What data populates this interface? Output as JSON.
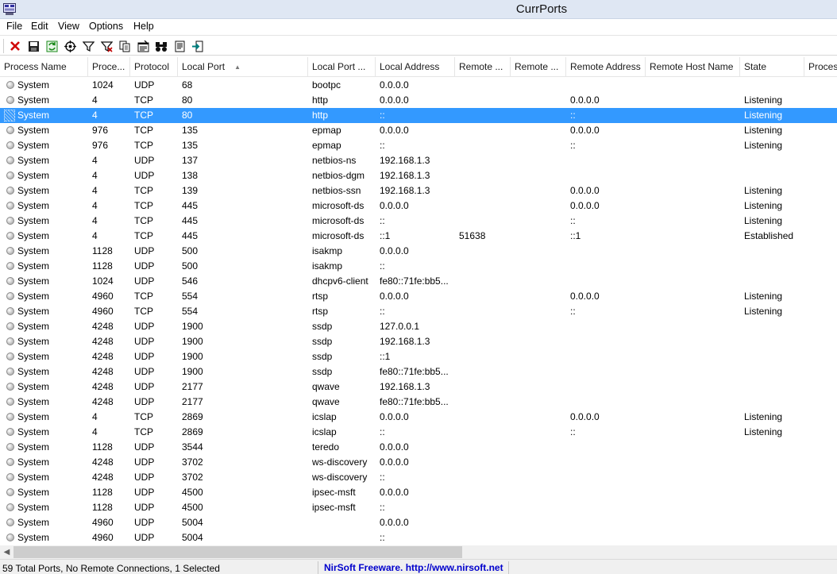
{
  "window": {
    "title": "CurrPorts"
  },
  "menu": [
    "File",
    "Edit",
    "View",
    "Options",
    "Help"
  ],
  "toolbar": {
    "buttons": [
      {
        "name": "close-connections-icon",
        "color": "#d00000"
      },
      {
        "name": "save-icon",
        "color": "#1a1a1a"
      },
      {
        "name": "refresh-icon",
        "color": "#1a8a1a"
      },
      {
        "name": "crosshair-icon",
        "color": "#1a1a1a"
      },
      {
        "name": "filter-icon",
        "color": "#1a1a1a"
      },
      {
        "name": "filter-red-icon",
        "color": "#c00000"
      },
      {
        "name": "copy-icon",
        "color": "#1a1a1a"
      },
      {
        "name": "properties-icon",
        "color": "#1a1a1a"
      },
      {
        "name": "find-binoculars-icon",
        "color": "#1a1a1a"
      },
      {
        "name": "html-report-icon",
        "color": "#1a1a1a"
      },
      {
        "name": "exit-icon",
        "color": "#008080"
      }
    ]
  },
  "columns": [
    "Process Name",
    "Proce...",
    "Protocol",
    "Local Port",
    "Local Port ...",
    "Local Address",
    "Remote ...",
    "Remote ...",
    "Remote Address",
    "Remote Host Name",
    "State",
    "Proces"
  ],
  "rows": [
    [
      "System",
      "1024",
      "UDP",
      "68",
      "bootpc",
      "0.0.0.0",
      "",
      "",
      "",
      "",
      "",
      ""
    ],
    [
      "System",
      "4",
      "TCP",
      "80",
      "http",
      "0.0.0.0",
      "",
      "",
      "0.0.0.0",
      "",
      "Listening",
      ""
    ],
    [
      "System",
      "4",
      "TCP",
      "80",
      "http",
      "::",
      "",
      "",
      "::",
      "",
      "Listening",
      ""
    ],
    [
      "System",
      "976",
      "TCP",
      "135",
      "epmap",
      "0.0.0.0",
      "",
      "",
      "0.0.0.0",
      "",
      "Listening",
      ""
    ],
    [
      "System",
      "976",
      "TCP",
      "135",
      "epmap",
      "::",
      "",
      "",
      "::",
      "",
      "Listening",
      ""
    ],
    [
      "System",
      "4",
      "UDP",
      "137",
      "netbios-ns",
      "192.168.1.3",
      "",
      "",
      "",
      "",
      "",
      ""
    ],
    [
      "System",
      "4",
      "UDP",
      "138",
      "netbios-dgm",
      "192.168.1.3",
      "",
      "",
      "",
      "",
      "",
      ""
    ],
    [
      "System",
      "4",
      "TCP",
      "139",
      "netbios-ssn",
      "192.168.1.3",
      "",
      "",
      "0.0.0.0",
      "",
      "Listening",
      ""
    ],
    [
      "System",
      "4",
      "TCP",
      "445",
      "microsoft-ds",
      "0.0.0.0",
      "",
      "",
      "0.0.0.0",
      "",
      "Listening",
      ""
    ],
    [
      "System",
      "4",
      "TCP",
      "445",
      "microsoft-ds",
      "::",
      "",
      "",
      "::",
      "",
      "Listening",
      ""
    ],
    [
      "System",
      "4",
      "TCP",
      "445",
      "microsoft-ds",
      "::1",
      "51638",
      "",
      "::1",
      "",
      "Established",
      ""
    ],
    [
      "System",
      "1128",
      "UDP",
      "500",
      "isakmp",
      "0.0.0.0",
      "",
      "",
      "",
      "",
      "",
      ""
    ],
    [
      "System",
      "1128",
      "UDP",
      "500",
      "isakmp",
      "::",
      "",
      "",
      "",
      "",
      "",
      ""
    ],
    [
      "System",
      "1024",
      "UDP",
      "546",
      "dhcpv6-client",
      "fe80::71fe:bb5...",
      "",
      "",
      "",
      "",
      "",
      ""
    ],
    [
      "System",
      "4960",
      "TCP",
      "554",
      "rtsp",
      "0.0.0.0",
      "",
      "",
      "0.0.0.0",
      "",
      "Listening",
      ""
    ],
    [
      "System",
      "4960",
      "TCP",
      "554",
      "rtsp",
      "::",
      "",
      "",
      "::",
      "",
      "Listening",
      ""
    ],
    [
      "System",
      "4248",
      "UDP",
      "1900",
      "ssdp",
      "127.0.0.1",
      "",
      "",
      "",
      "",
      "",
      ""
    ],
    [
      "System",
      "4248",
      "UDP",
      "1900",
      "ssdp",
      "192.168.1.3",
      "",
      "",
      "",
      "",
      "",
      ""
    ],
    [
      "System",
      "4248",
      "UDP",
      "1900",
      "ssdp",
      "::1",
      "",
      "",
      "",
      "",
      "",
      ""
    ],
    [
      "System",
      "4248",
      "UDP",
      "1900",
      "ssdp",
      "fe80::71fe:bb5...",
      "",
      "",
      "",
      "",
      "",
      ""
    ],
    [
      "System",
      "4248",
      "UDP",
      "2177",
      "qwave",
      "192.168.1.3",
      "",
      "",
      "",
      "",
      "",
      ""
    ],
    [
      "System",
      "4248",
      "UDP",
      "2177",
      "qwave",
      "fe80::71fe:bb5...",
      "",
      "",
      "",
      "",
      "",
      ""
    ],
    [
      "System",
      "4",
      "TCP",
      "2869",
      "icslap",
      "0.0.0.0",
      "",
      "",
      "0.0.0.0",
      "",
      "Listening",
      ""
    ],
    [
      "System",
      "4",
      "TCP",
      "2869",
      "icslap",
      "::",
      "",
      "",
      "::",
      "",
      "Listening",
      ""
    ],
    [
      "System",
      "1128",
      "UDP",
      "3544",
      "teredo",
      "0.0.0.0",
      "",
      "",
      "",
      "",
      "",
      ""
    ],
    [
      "System",
      "4248",
      "UDP",
      "3702",
      "ws-discovery",
      "0.0.0.0",
      "",
      "",
      "",
      "",
      "",
      ""
    ],
    [
      "System",
      "4248",
      "UDP",
      "3702",
      "ws-discovery",
      "::",
      "",
      "",
      "",
      "",
      "",
      ""
    ],
    [
      "System",
      "1128",
      "UDP",
      "4500",
      "ipsec-msft",
      "0.0.0.0",
      "",
      "",
      "",
      "",
      "",
      ""
    ],
    [
      "System",
      "1128",
      "UDP",
      "4500",
      "ipsec-msft",
      "::",
      "",
      "",
      "",
      "",
      "",
      ""
    ],
    [
      "System",
      "4960",
      "UDP",
      "5004",
      "",
      "0.0.0.0",
      "",
      "",
      "",
      "",
      "",
      ""
    ],
    [
      "System",
      "4960",
      "UDP",
      "5004",
      "",
      "::",
      "",
      "",
      "",
      "",
      "",
      ""
    ]
  ],
  "selected_row": 2,
  "status": {
    "summary": "59 Total Ports, No Remote Connections, 1 Selected",
    "link": "NirSoft Freeware.  http://www.nirsoft.net"
  },
  "colors": {
    "selection": "#3399ff",
    "link": "#0000cc",
    "titlebar": "#dfe7f3"
  }
}
